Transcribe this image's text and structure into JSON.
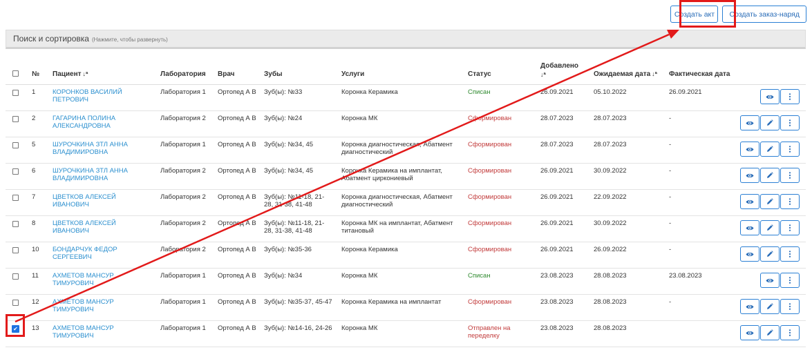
{
  "toolbar": {
    "create_act_label": "Создать акт",
    "create_order_label": "Создать заказ-наряд"
  },
  "search": {
    "title": "Поиск и сортировка",
    "hint": "(Нажмите, чтобы развернуть)"
  },
  "columns": {
    "num": "№",
    "patient": "Пациент",
    "lab": "Лаборатория",
    "doctor": "Врач",
    "teeth": "Зубы",
    "services": "Услуги",
    "status": "Статус",
    "added": "Добавлено",
    "expected": "Ожидаемая дата",
    "actual": "Фактическая дата",
    "sort_icon": "↓ª"
  },
  "rows": [
    {
      "num": "1",
      "patient": "КОРОНКОВ ВАСИЛИЙ ПЕТРОВИЧ",
      "lab": "Лаборатория 1",
      "doctor": "Ортопед А В",
      "teeth": "Зуб(ы): №33",
      "services": "Коронка Керамика",
      "status": "Списан",
      "status_kind": "green",
      "added": "26.09.2021",
      "expected": "05.10.2022",
      "actual": "26.09.2021",
      "checked": false,
      "has_edit": false
    },
    {
      "num": "2",
      "patient": "ГАГАРИНА ПОЛИНА АЛЕКСАНДРОВНА",
      "lab": "Лаборатория 2",
      "doctor": "Ортопед А В",
      "teeth": "Зуб(ы): №24",
      "services": "Коронка МК",
      "status": "Сформирован",
      "status_kind": "red",
      "added": "28.07.2023",
      "expected": "28.07.2023",
      "actual": "-",
      "checked": false,
      "has_edit": true
    },
    {
      "num": "5",
      "patient": "ШУРОЧКИНА ЗТЛ АННА ВЛАДИМИРОВНА",
      "lab": "Лаборатория 1",
      "doctor": "Ортопед А В",
      "teeth": "Зуб(ы): №34, 45",
      "services": "Коронка диагностическая, Абатмент диагностический",
      "status": "Сформирован",
      "status_kind": "red",
      "added": "28.07.2023",
      "expected": "28.07.2023",
      "actual": "-",
      "checked": false,
      "has_edit": true
    },
    {
      "num": "6",
      "patient": "ШУРОЧКИНА ЗТЛ АННА ВЛАДИМИРОВНА",
      "lab": "Лаборатория 2",
      "doctor": "Ортопед А В",
      "teeth": "Зуб(ы): №34, 45",
      "services": "Коронка Керамика на имплантат, Абатмент циркониевый",
      "status": "Сформирован",
      "status_kind": "red",
      "added": "26.09.2021",
      "expected": "30.09.2022",
      "actual": "-",
      "checked": false,
      "has_edit": true
    },
    {
      "num": "7",
      "patient": "ЦВЕТКОВ АЛЕКСЕЙ ИВАНОВИЧ",
      "lab": "Лаборатория 2",
      "doctor": "Ортопед А В",
      "teeth": "Зуб(ы): №11-18, 21-28, 31-38, 41-48",
      "services": "Коронка диагностическая, Абатмент диагностический",
      "status": "Сформирован",
      "status_kind": "red",
      "added": "26.09.2021",
      "expected": "22.09.2022",
      "actual": "-",
      "checked": false,
      "has_edit": true
    },
    {
      "num": "8",
      "patient": "ЦВЕТКОВ АЛЕКСЕЙ ИВАНОВИЧ",
      "lab": "Лаборатория 2",
      "doctor": "Ортопед А В",
      "teeth": "Зуб(ы): №11-18, 21-28, 31-38, 41-48",
      "services": "Коронка МК на имплантат, Абатмент титановый",
      "status": "Сформирован",
      "status_kind": "red",
      "added": "26.09.2021",
      "expected": "30.09.2022",
      "actual": "-",
      "checked": false,
      "has_edit": true
    },
    {
      "num": "10",
      "patient": "БОНДАРЧУК ФЕДОР СЕРГЕЕВИЧ",
      "lab": "Лаборатория 2",
      "doctor": "Ортопед А В",
      "teeth": "Зуб(ы): №35-36",
      "services": "Коронка Керамика",
      "status": "Сформирован",
      "status_kind": "red",
      "added": "26.09.2021",
      "expected": "26.09.2022",
      "actual": "-",
      "checked": false,
      "has_edit": true
    },
    {
      "num": "11",
      "patient": "АХМЕТОВ МАНСУР ТИМУРОВИЧ",
      "lab": "Лаборатория 1",
      "doctor": "Ортопед А В",
      "teeth": "Зуб(ы): №34",
      "services": "Коронка МК",
      "status": "Списан",
      "status_kind": "green",
      "added": "23.08.2023",
      "expected": "28.08.2023",
      "actual": "23.08.2023",
      "checked": false,
      "has_edit": false
    },
    {
      "num": "12",
      "patient": "АХМЕТОВ МАНСУР ТИМУРОВИЧ",
      "lab": "Лаборатория 1",
      "doctor": "Ортопед А В",
      "teeth": "Зуб(ы): №35-37, 45-47",
      "services": "Коронка Керамика на имплантат",
      "status": "Сформирован",
      "status_kind": "red",
      "added": "23.08.2023",
      "expected": "28.08.2023",
      "actual": "-",
      "checked": false,
      "has_edit": true
    },
    {
      "num": "13",
      "patient": "АХМЕТОВ МАНСУР ТИМУРОВИЧ",
      "lab": "Лаборатория 1",
      "doctor": "Ортопед А В",
      "teeth": "Зуб(ы): №14-16, 24-26",
      "services": "Коронка МК",
      "status": "Отправлен на переделку",
      "status_kind": "red",
      "added": "23.08.2023",
      "expected": "28.08.2023",
      "actual": "",
      "checked": true,
      "has_edit": true
    }
  ],
  "colors": {
    "accent": "#2a7fd4",
    "link": "#2b8fcf",
    "status_green": "#2f8a2f",
    "status_red": "#c23b3b",
    "annotation": "#e21a1a"
  },
  "icons": {
    "view": "eye-icon",
    "edit": "pencil-icon",
    "menu": "kebab-menu-icon",
    "sort": "sort-icon"
  }
}
